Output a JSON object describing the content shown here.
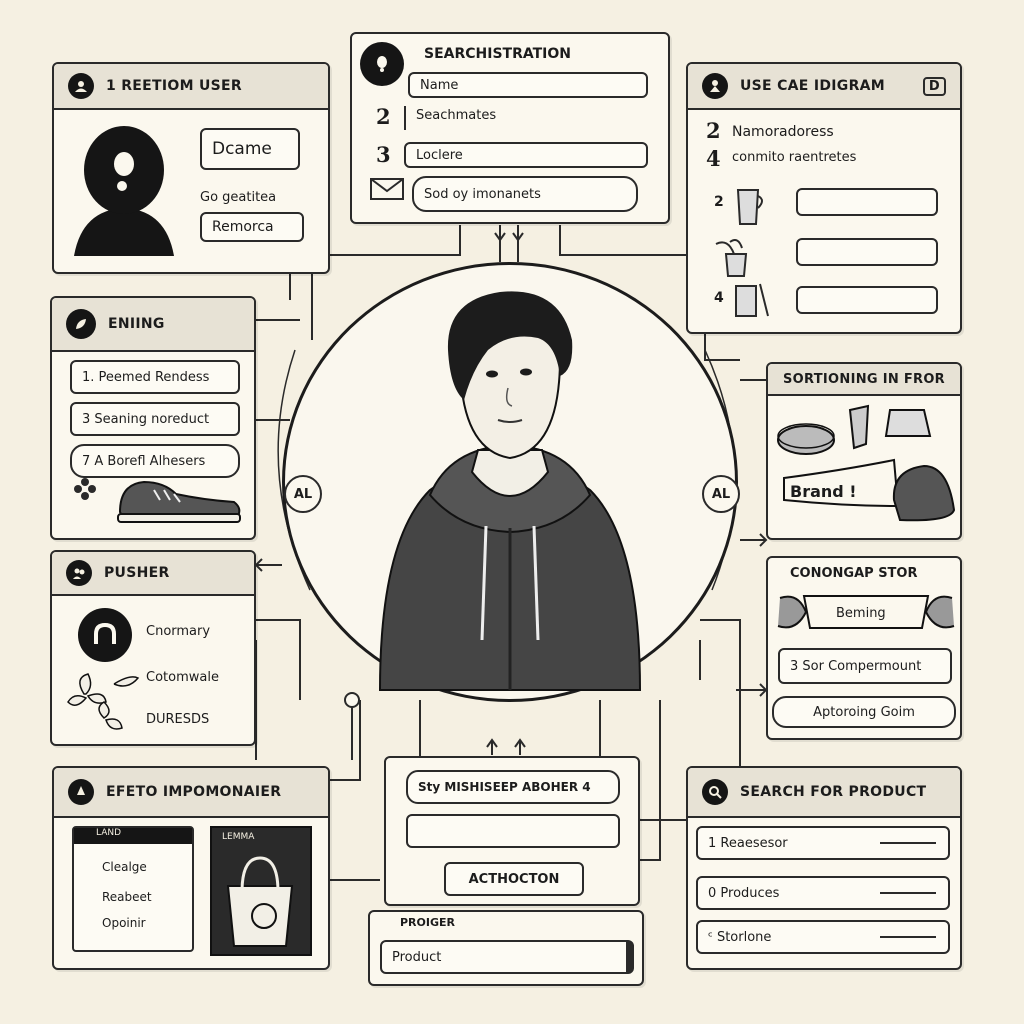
{
  "panels": {
    "user": {
      "title": "1 REETIOM USER",
      "name_box": "Dcame",
      "line": "Go geatitea",
      "remove_box": "Remorca"
    },
    "search_registration": {
      "title": "SEARCHISTRATION",
      "name_field": "Name",
      "row2_num": "2",
      "row2_text": "Seachmates",
      "row3_num": "3",
      "row3_field": "Loclere",
      "bottom_field": "Sod oy imonanets"
    },
    "use_case": {
      "title": "USE CAE IDIGRAM",
      "badge": "D",
      "row1_num": "2",
      "row1_text": "Namoradoress",
      "row2_num": "4",
      "row2_text": "conmito raentretes",
      "items": [
        {
          "num": "2"
        },
        {
          "num": ""
        },
        {
          "num": "4"
        }
      ]
    },
    "ending": {
      "title": "ENIING",
      "items": [
        "1. Peemed Rendess",
        "3 Seaning noreduct",
        "7  A Borefl Alhesers"
      ]
    },
    "sorting": {
      "title": "SORTIONING IN FROR",
      "brand": "Brand !"
    },
    "pusher": {
      "title": "PUSHER",
      "lines": [
        "Cnormary",
        "Cotomwale",
        "DURESDS"
      ]
    },
    "conongap": {
      "title": "CONONGAP STOR",
      "banner": "Beming",
      "field1": "3 Sor Compermount",
      "field2": "Aptoroing Goim"
    },
    "effeto": {
      "title": "EFETO IMPOMONAIER",
      "list_header": "LAND",
      "list_items": [
        "Clealge",
        "Reabeet",
        "Opoinir"
      ],
      "card_label": "LEMMA"
    },
    "center": {
      "field1": "Sty MISHISEEP ABOHER 4",
      "button": "ACTHOCTON"
    },
    "product": {
      "title": "PROIGER",
      "field": "Product"
    },
    "search_product": {
      "title": "SEARCH FOR PRODUCT",
      "items": [
        "1  Reaesesor",
        "0 Produces",
        "ᶜ  Storlone"
      ]
    },
    "hub": {
      "left_tag": "AL",
      "right_tag": "AL"
    }
  }
}
